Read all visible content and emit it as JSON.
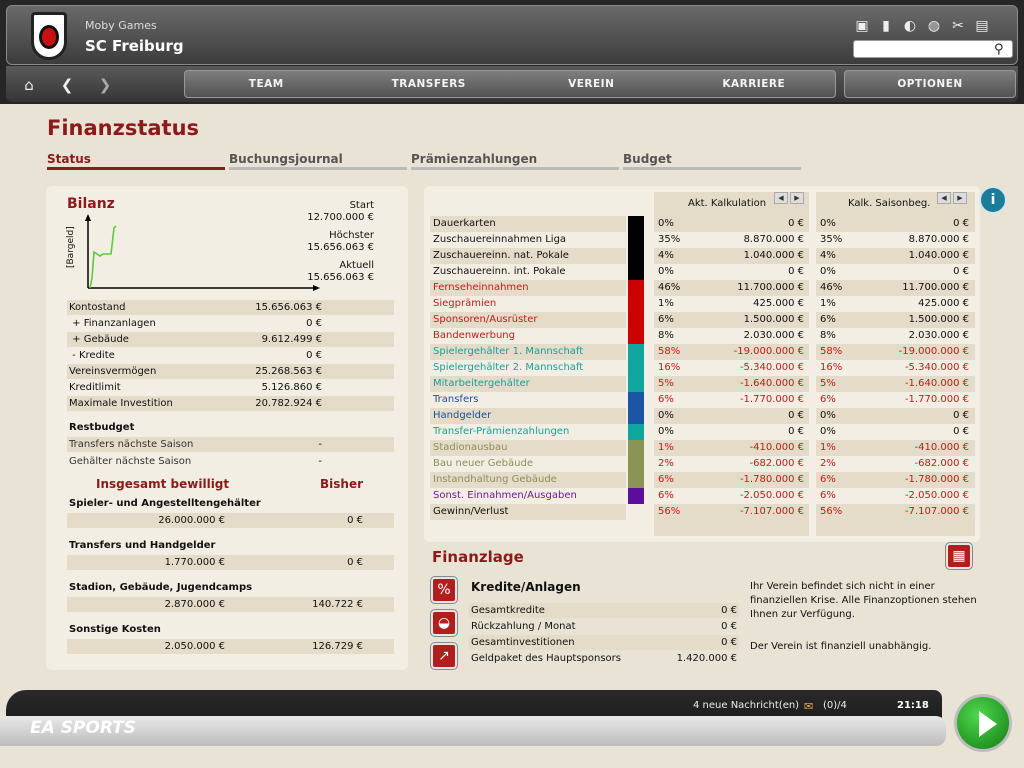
{
  "header": {
    "game": "Moby Games",
    "club": "SC Freiburg",
    "search_placeholder": "",
    "icons": [
      "window-icon",
      "stats-icon",
      "refresh-icon",
      "globe-icon",
      "tools-icon",
      "document-icon"
    ]
  },
  "nav": {
    "tabs": [
      "TEAM",
      "TRANSFERS",
      "VEREIN",
      "KARRIERE"
    ],
    "options": "OPTIONEN"
  },
  "page": {
    "title": "Finanzstatus",
    "subtabs": [
      "Status",
      "Buchungsjournal",
      "Prämienzahlungen",
      "Budget"
    ]
  },
  "bilanz": {
    "title": "Bilanz",
    "axis": "[Bargeld]",
    "start_label": "Start",
    "start_value": "12.700.000 €",
    "max_label": "Höchster",
    "max_value": "15.656.063 €",
    "cur_label": "Aktuell",
    "cur_value": "15.656.063 €",
    "rows": [
      [
        "Kontostand",
        "15.656.063 €"
      ],
      [
        " + Finanzanlagen",
        "0 €"
      ],
      [
        " + Gebäude",
        "9.612.499 €"
      ],
      [
        " - Kredite",
        "0 €"
      ],
      [
        "Vereinsvermögen",
        "25.268.563 €"
      ],
      [
        "Kreditlimit",
        "5.126.860 €"
      ],
      [
        "Maximale Investition",
        "20.782.924 €"
      ]
    ],
    "restbudget": "Restbudget",
    "rest_rows": [
      [
        "Transfers nächste Saison",
        "-"
      ],
      [
        "Gehälter nächste Saison",
        "-"
      ]
    ],
    "bew_label": "Insgesamt bewilligt",
    "bis_label": "Bisher",
    "budgets": [
      [
        "Spieler- und Angestelltengehälter",
        "26.000.000 €",
        "0 €"
      ],
      [
        "Transfers und Handgelder",
        "1.770.000 €",
        "0 €"
      ],
      [
        "Stadion, Gebäude, Jugendcamps",
        "2.870.000 €",
        "140.722 €"
      ],
      [
        "Sonstige Kosten",
        "2.050.000 €",
        "126.729 €"
      ]
    ]
  },
  "table": {
    "col1": "Akt. Kalkulation",
    "col2": "Kalk. Saisonbeg.",
    "rows": [
      [
        "Dauerkarten",
        "0%",
        "0 €",
        "0%",
        "0 €"
      ],
      [
        "Zuschauereinnahmen Liga",
        "35%",
        "8.870.000 €",
        "35%",
        "8.870.000 €"
      ],
      [
        "Zuschauereinn. nat. Pokale",
        "4%",
        "1.040.000 €",
        "4%",
        "1.040.000 €"
      ],
      [
        "Zuschauereinn. int. Pokale",
        "0%",
        "0 €",
        "0%",
        "0 €"
      ],
      [
        "Fernseheinnahmen",
        "46%",
        "11.700.000 €",
        "46%",
        "11.700.000 €"
      ],
      [
        "Siegprämien",
        "1%",
        "425.000 €",
        "1%",
        "425.000 €"
      ],
      [
        "Sponsoren/Ausrüster",
        "6%",
        "1.500.000 €",
        "6%",
        "1.500.000 €"
      ],
      [
        "Bandenwerbung",
        "8%",
        "2.030.000 €",
        "8%",
        "2.030.000 €"
      ],
      [
        "Spielergehälter 1. Mannschaft",
        "58%",
        "-19.000.000 €",
        "58%",
        "-19.000.000 €"
      ],
      [
        "Spielergehälter 2. Mannschaft",
        "16%",
        "-5.340.000 €",
        "16%",
        "-5.340.000 €"
      ],
      [
        "Mitarbeitergehälter",
        "5%",
        "-1.640.000 €",
        "5%",
        "-1.640.000 €"
      ],
      [
        "Transfers",
        "6%",
        "-1.770.000 €",
        "6%",
        "-1.770.000 €"
      ],
      [
        "Handgelder",
        "0%",
        "0 €",
        "0%",
        "0 €"
      ],
      [
        "Transfer-Prämienzahlungen",
        "0%",
        "0 €",
        "0%",
        "0 €"
      ],
      [
        "Stadionausbau",
        "1%",
        "-410.000 €",
        "1%",
        "-410.000 €"
      ],
      [
        "Bau neuer Gebäude",
        "2%",
        "-682.000 €",
        "2%",
        "-682.000 €"
      ],
      [
        "Instandhaltung Gebäude",
        "6%",
        "-1.780.000 €",
        "6%",
        "-1.780.000 €"
      ],
      [
        "Sonst. Einnahmen/Ausgaben",
        "6%",
        "-2.050.000 €",
        "6%",
        "-2.050.000 €"
      ],
      [
        "Gewinn/Verlust",
        "56%",
        "-7.107.000 €",
        "56%",
        "-7.107.000 €"
      ]
    ],
    "label_colors": [
      "#111",
      "#111",
      "#111",
      "#111",
      "#c21a1a",
      "#c21a1a",
      "#c21a1a",
      "#c21a1a",
      "#12a29a",
      "#12a29a",
      "#12a29a",
      "#1a4f9a",
      "#1a4f9a",
      "#12a29a",
      "#8a8f5a",
      "#8a8f5a",
      "#8a8f5a",
      "#6a1a9a",
      "#111"
    ],
    "bar_colors": [
      "#000",
      "#000",
      "#000",
      "#000",
      "#cc0000",
      "#cc0000",
      "#cc0000",
      "#cc0000",
      "#10a69e",
      "#10a69e",
      "#10a69e",
      "#1b55a3",
      "#1b55a3",
      "#10a69e",
      "#8b9457",
      "#8b9457",
      "#8b9457",
      "#5a0e9a",
      ""
    ]
  },
  "finanzlage": {
    "title": "Finanzlage",
    "sub": "Kredite/Anlagen",
    "rows": [
      [
        "Gesamtkredite",
        "0 €"
      ],
      [
        "Rückzahlung / Monat",
        "0 €"
      ],
      [
        "Gesamtinvestitionen",
        "0 €"
      ],
      [
        "Geldpaket des Hauptsponsors",
        "1.420.000 €"
      ]
    ],
    "text1": "Ihr Verein befindet sich nicht in einer finanziellen Krise. Alle Finanzoptionen stehen Ihnen zur Verfügung.",
    "text2": "Der Verein ist finanziell unabhängig."
  },
  "footer": {
    "logo": "EA SPORTS",
    "messages": "4 neue Nachricht(en)",
    "mail": "(0)/4",
    "time": "21:18"
  }
}
